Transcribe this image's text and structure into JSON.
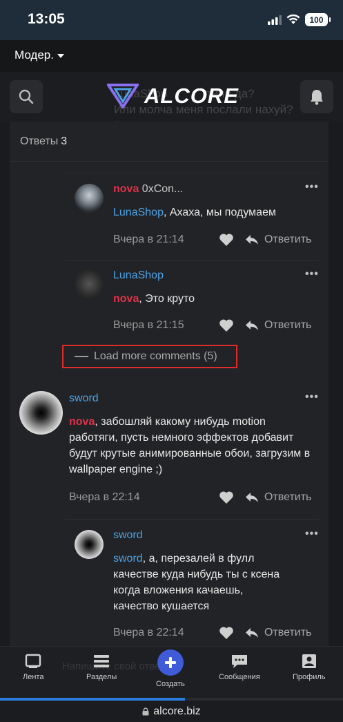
{
  "status": {
    "time": "13:05",
    "battery": "100"
  },
  "header": {
    "moder_label": "Модер.",
    "logo_text": "ALCORE"
  },
  "ghost_text": {
    "author": "LunaShop",
    "line1": "типа да?",
    "line2": "Или молча меня послали нахуй?",
    "line3": "?"
  },
  "replies": {
    "label": "Ответы",
    "count": "3"
  },
  "comments": [
    {
      "author": "nova",
      "author_suffix": "0xCon...",
      "mention": "LunaShop",
      "text": ", Ахаха, мы подумаем",
      "time": "Вчера в 21:14",
      "reply_label": "Ответить"
    },
    {
      "author": "LunaShop",
      "mention": "nova",
      "text": ", Это круто",
      "time": "Вчера в 21:15",
      "reply_label": "Ответить"
    }
  ],
  "load_more": {
    "label": "Load more comments (5)"
  },
  "post": {
    "author": "sword",
    "mention": "nova",
    "text": ", забошляй какому нибудь motion работяги, пусть немного эффектов добавит будут крутые анимированные обои, загрузим в wallpaper engine ;)",
    "time": "Вчера в 22:14",
    "reply_label": "Ответить"
  },
  "sub_reply": {
    "author": "sword",
    "mention": "sword",
    "text": ", а, перезалей в фулл качестве куда нибудь ты с ксена когда вложения качаешь, качество кушается",
    "time": "Вчера в 22:14",
    "reply_label": "Ответить"
  },
  "bottom_nav": {
    "ghost_placeholder": "Напишите свой ответ...",
    "items": [
      {
        "label": "Лента",
        "icon": "feed-icon"
      },
      {
        "label": "Разделы",
        "icon": "sections-icon"
      },
      {
        "label": "Создать",
        "icon": "plus-icon"
      },
      {
        "label": "Сообщения",
        "icon": "chat-icon"
      },
      {
        "label": "Профиль",
        "icon": "profile-icon"
      }
    ]
  },
  "page_load_progress": 0.54,
  "url": "alcore.biz",
  "colors": {
    "accent": "#4da3e6",
    "mention_red": "#e0314b",
    "create_button": "#3f5bd8",
    "highlight_border": "#e12b2b"
  }
}
